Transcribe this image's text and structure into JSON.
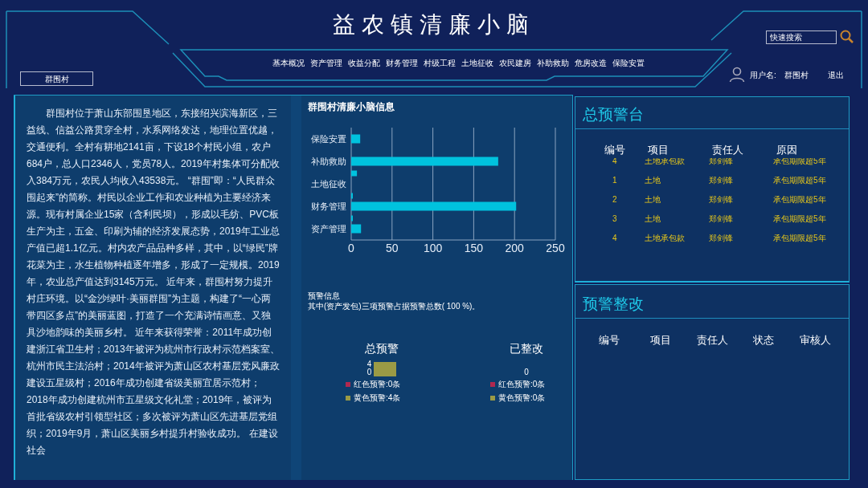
{
  "title": "益农镇清廉小脑",
  "search": {
    "placeholder": "快速搜索"
  },
  "nav": [
    "基本概况",
    "资产管理",
    "收益分配",
    "财务管理",
    "村级工程",
    "土地征收",
    "农民建房",
    "补助救助",
    "危房改造",
    "保险安置"
  ],
  "village_button": "群围村",
  "user": {
    "label": "用户名:",
    "name": "群围村",
    "logout": "退出"
  },
  "intro": "群围村位于萧山东部围垦地区，东接绍兴滨海新区，三益线、信益公路贯穿全村，水系网络发达，地理位置优越，交通便利。全村有耕地2141亩，下设18个村民小组，农户684户，总人口2346人，党员78人。2019年村集体可分配收入384万元，农民人均收入43538元。 “群围”即：“人民群众围起来”的简称。村民以企业工作和农业种植为主要经济来源。现有村属企业15家（含利民坝），形成以毛纺、PVC板生产为主，五金、印刷为辅的经济发展态势，2019年工业总产值已超1.1亿元。村内农产品品种多样，其中，以“绿民”牌花菜为主，水生植物种植逐年增多，形成了一定规模。2019年，农业总产值达到3145万元。 近年来，群围村努力提升村庄环境。以“金沙绿叶·美丽群围”为主题，构建了“一心两带四区多点”的美丽蓝图，打造了一个充满诗情画意、又独具沙地韵味的美丽乡村。 近年来获得荣誉：2011年成功创建浙江省卫生村；2013年被评为杭州市行政村示范档案室、杭州市民主法治村；2014年被评为萧山区农村基层党风廉政建设五星级村；2016年成功创建省级美丽宜居示范村；2018年成功创建杭州市五星级文化礼堂；2019年，被评为首批省级农村引领型社区；多次被评为萧山区先进基层党组织；2019年9月，萧山区美丽乡村提升村验收成功。 在建设社会",
  "info_panel": {
    "title": "群围村清廉小脑信息",
    "chart_data": {
      "type": "bar",
      "orientation": "horizontal",
      "grid": true,
      "categories": [
        "保险安置",
        "补助救助",
        "土地征收",
        "财务管理",
        "资产管理"
      ],
      "series": [
        {
          "color": "#00c2de",
          "values": [
            0,
            0,
            7,
            1,
            1
          ]
        },
        {
          "color": "#00c2de",
          "values": [
            11,
            180,
            0,
            202,
            12
          ]
        }
      ],
      "xlim": [
        0,
        250
      ],
      "xticks": [
        0,
        50,
        100,
        150,
        200,
        250
      ]
    },
    "warning_heading": "预警信息",
    "warning_text": "其中(资产发包)三项预警占据预警总数( 100 %)。",
    "summaries": [
      {
        "title": "总预警",
        "mini_bar": {
          "top_label": "4",
          "bottom_label": "0",
          "color": "#9a9a45"
        },
        "legend": [
          {
            "label": "红色预警:0条",
            "color": "#b0284f"
          },
          {
            "label": "黄色预警:4条",
            "color": "#9a9a45"
          }
        ]
      },
      {
        "title": "已整改",
        "mini_bar": {
          "top_label": "0"
        },
        "legend": [
          {
            "label": "红色预警:0条",
            "color": "#b0284f"
          },
          {
            "label": "黄色预警:0条",
            "color": "#9a9a45"
          }
        ]
      }
    ]
  },
  "alerts": {
    "title": "总预警台",
    "columns": [
      "编号",
      "项目",
      "责任人",
      "原因"
    ],
    "rows": [
      [
        "4",
        "土地承包款",
        "郑剑锋",
        "承包期限超5年"
      ],
      [
        "1",
        "土地",
        "郑剑锋",
        "承包期限超5年"
      ],
      [
        "2",
        "土地",
        "郑剑锋",
        "承包期限超5年"
      ],
      [
        "3",
        "土地",
        "郑剑锋",
        "承包期限超5年"
      ],
      [
        "4",
        "土地承包款",
        "郑剑锋",
        "承包期限超5年"
      ]
    ]
  },
  "rectify": {
    "title": "预警整改",
    "columns": [
      "编号",
      "项目",
      "责任人",
      "状态",
      "审核人"
    ]
  }
}
